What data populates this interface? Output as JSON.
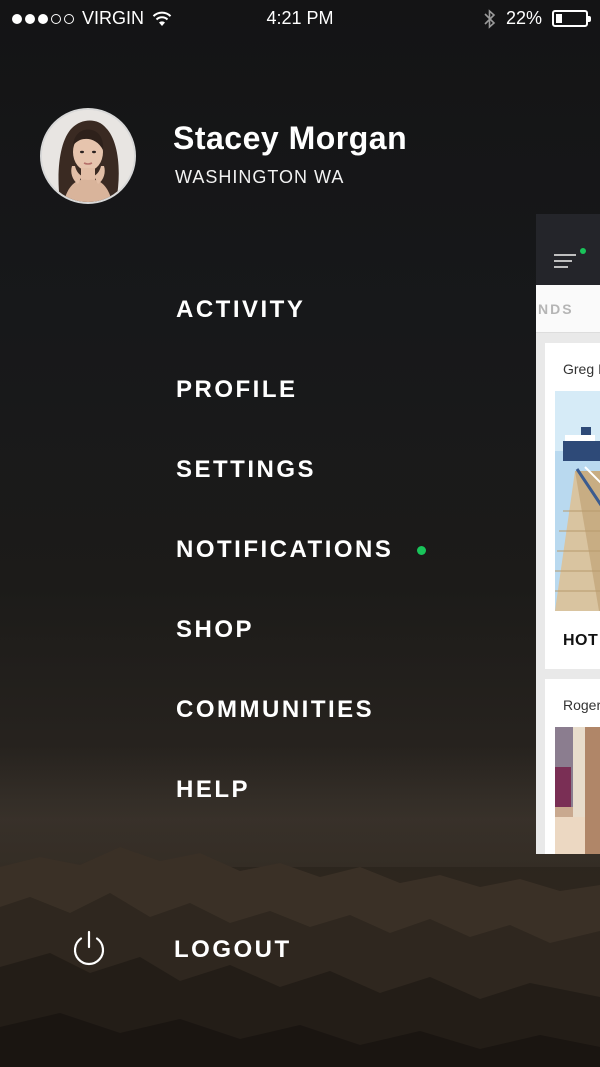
{
  "status_bar": {
    "carrier": "VIRGIN",
    "time": "4:21 PM",
    "battery_percent": "22%",
    "battery_level": 0.22,
    "signal_bars_filled": 3,
    "signal_bars_total": 5
  },
  "user": {
    "name": "Stacey Morgan",
    "location": "WASHINGTON WA"
  },
  "menu": {
    "items": [
      {
        "label": "ACTIVITY"
      },
      {
        "label": "PROFILE"
      },
      {
        "label": "SETTINGS"
      },
      {
        "label": "NOTIFICATIONS",
        "has_indicator": true
      },
      {
        "label": "SHOP"
      },
      {
        "label": "COMMUNITIES"
      },
      {
        "label": "HELP"
      }
    ],
    "logout_label": "LOGOUT"
  },
  "main_panel": {
    "tab_label": "NDS",
    "cards": [
      {
        "author": "Greg I",
        "title": "HOT"
      },
      {
        "author": "Roger"
      }
    ]
  },
  "colors": {
    "accent_green": "#19c45a",
    "panel_header": "#24252a"
  },
  "icons": {
    "logout": "power-icon",
    "menu": "hamburger-menu-icon",
    "wifi": "wifi-icon",
    "bluetooth": "bluetooth-icon",
    "battery": "battery-icon"
  }
}
